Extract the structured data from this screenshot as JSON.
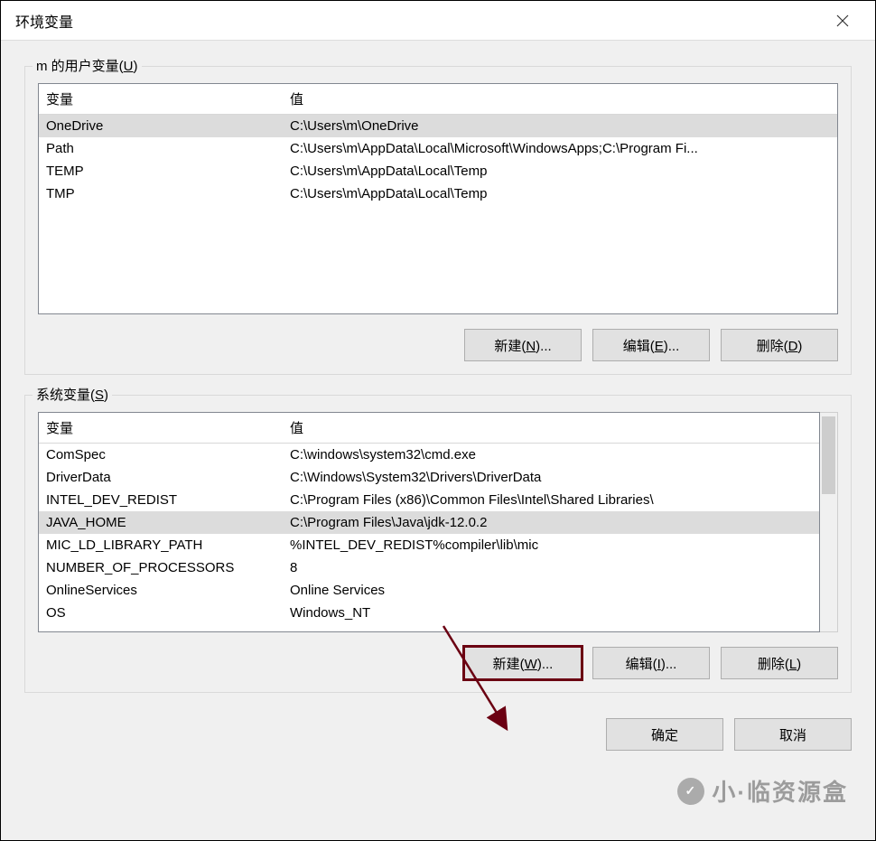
{
  "window": {
    "title": "环境变量"
  },
  "user_group": {
    "label_prefix": "m 的用户变量(",
    "label_hotkey": "U",
    "label_suffix": ")",
    "header_var": "变量",
    "header_val": "值",
    "rows": [
      {
        "var": "OneDrive",
        "val": "C:\\Users\\m\\OneDrive",
        "selected": true
      },
      {
        "var": "Path",
        "val": "C:\\Users\\m\\AppData\\Local\\Microsoft\\WindowsApps;C:\\Program Fi...",
        "selected": false
      },
      {
        "var": "TEMP",
        "val": "C:\\Users\\m\\AppData\\Local\\Temp",
        "selected": false
      },
      {
        "var": "TMP",
        "val": "C:\\Users\\m\\AppData\\Local\\Temp",
        "selected": false
      }
    ],
    "buttons": {
      "new": {
        "pre": "新建(",
        "hot": "N",
        "post": ")..."
      },
      "edit": {
        "pre": "编辑(",
        "hot": "E",
        "post": ")..."
      },
      "delete": {
        "pre": "删除(",
        "hot": "D",
        "post": ")"
      }
    }
  },
  "sys_group": {
    "label_prefix": "系统变量(",
    "label_hotkey": "S",
    "label_suffix": ")",
    "header_var": "变量",
    "header_val": "值",
    "rows": [
      {
        "var": "ComSpec",
        "val": "C:\\windows\\system32\\cmd.exe",
        "selected": false
      },
      {
        "var": "DriverData",
        "val": "C:\\Windows\\System32\\Drivers\\DriverData",
        "selected": false
      },
      {
        "var": "INTEL_DEV_REDIST",
        "val": "C:\\Program Files (x86)\\Common Files\\Intel\\Shared Libraries\\",
        "selected": false
      },
      {
        "var": "JAVA_HOME",
        "val": "C:\\Program Files\\Java\\jdk-12.0.2",
        "selected": true
      },
      {
        "var": "MIC_LD_LIBRARY_PATH",
        "val": "%INTEL_DEV_REDIST%compiler\\lib\\mic",
        "selected": false
      },
      {
        "var": "NUMBER_OF_PROCESSORS",
        "val": "8",
        "selected": false
      },
      {
        "var": "OnlineServices",
        "val": "Online Services",
        "selected": false
      },
      {
        "var": "OS",
        "val": "Windows_NT",
        "selected": false
      }
    ],
    "buttons": {
      "new": {
        "pre": "新建(",
        "hot": "W",
        "post": ")..."
      },
      "edit": {
        "pre": "编辑(",
        "hot": "I",
        "post": ")..."
      },
      "delete": {
        "pre": "删除(",
        "hot": "L",
        "post": ")"
      }
    }
  },
  "dialog_buttons": {
    "ok": "确定",
    "cancel": "取消"
  },
  "watermark": "小·临资源盒",
  "colors": {
    "arrow": "#6b0012"
  }
}
